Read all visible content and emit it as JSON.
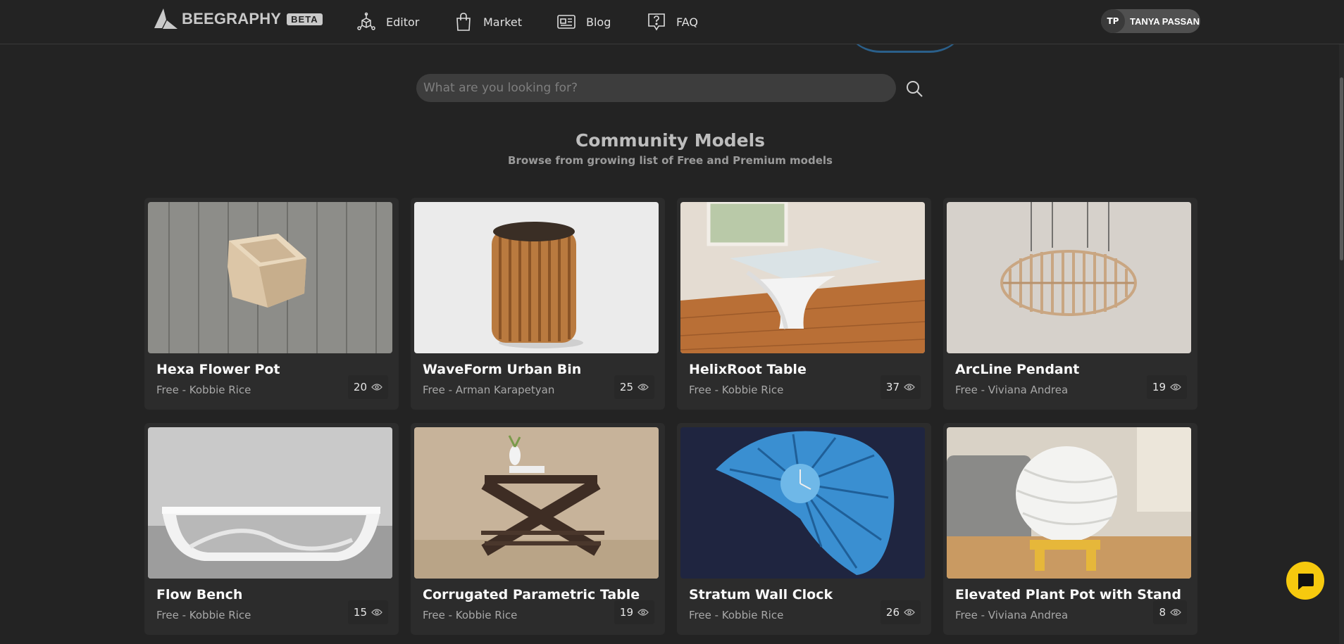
{
  "header": {
    "logo_text": "BEEGRAPHY",
    "beta_label": "BETA",
    "nav": [
      {
        "label": "Editor",
        "icon": "editor-icon"
      },
      {
        "label": "Market",
        "icon": "shopping-bag-icon"
      },
      {
        "label": "Blog",
        "icon": "blog-icon"
      },
      {
        "label": "FAQ",
        "icon": "faq-icon"
      }
    ],
    "user": {
      "initials": "TP",
      "name": "TANYA PASSAN"
    }
  },
  "search": {
    "placeholder": "What are you looking for?"
  },
  "section": {
    "title": "Community Models",
    "subtitle": "Browse from growing list of Free and Premium models"
  },
  "models": [
    {
      "name": "Hexa Flower Pot",
      "meta": "Free - Kobbie Rice",
      "views": "20"
    },
    {
      "name": "WaveForm Urban Bin",
      "meta": "Free - Arman Karapetyan",
      "views": "25"
    },
    {
      "name": "HelixRoot Table",
      "meta": "Free - Kobbie Rice",
      "views": "37"
    },
    {
      "name": "ArcLine Pendant",
      "meta": "Free - Viviana Andrea",
      "views": "19"
    },
    {
      "name": "Flow Bench",
      "meta": "Free - Kobbie Rice",
      "views": "15"
    },
    {
      "name": "Corrugated Parametric Table",
      "meta": "Free - Kobbie Rice",
      "views": "19"
    },
    {
      "name": "Stratum Wall Clock",
      "meta": "Free - Kobbie Rice",
      "views": "26"
    },
    {
      "name": "Elevated Plant Pot with Stand",
      "meta": "Free - Viviana Andrea",
      "views": "8"
    }
  ],
  "colors": {
    "background": "#232323",
    "card": "#2c2c2c",
    "chat_accent": "#f6c90e"
  }
}
